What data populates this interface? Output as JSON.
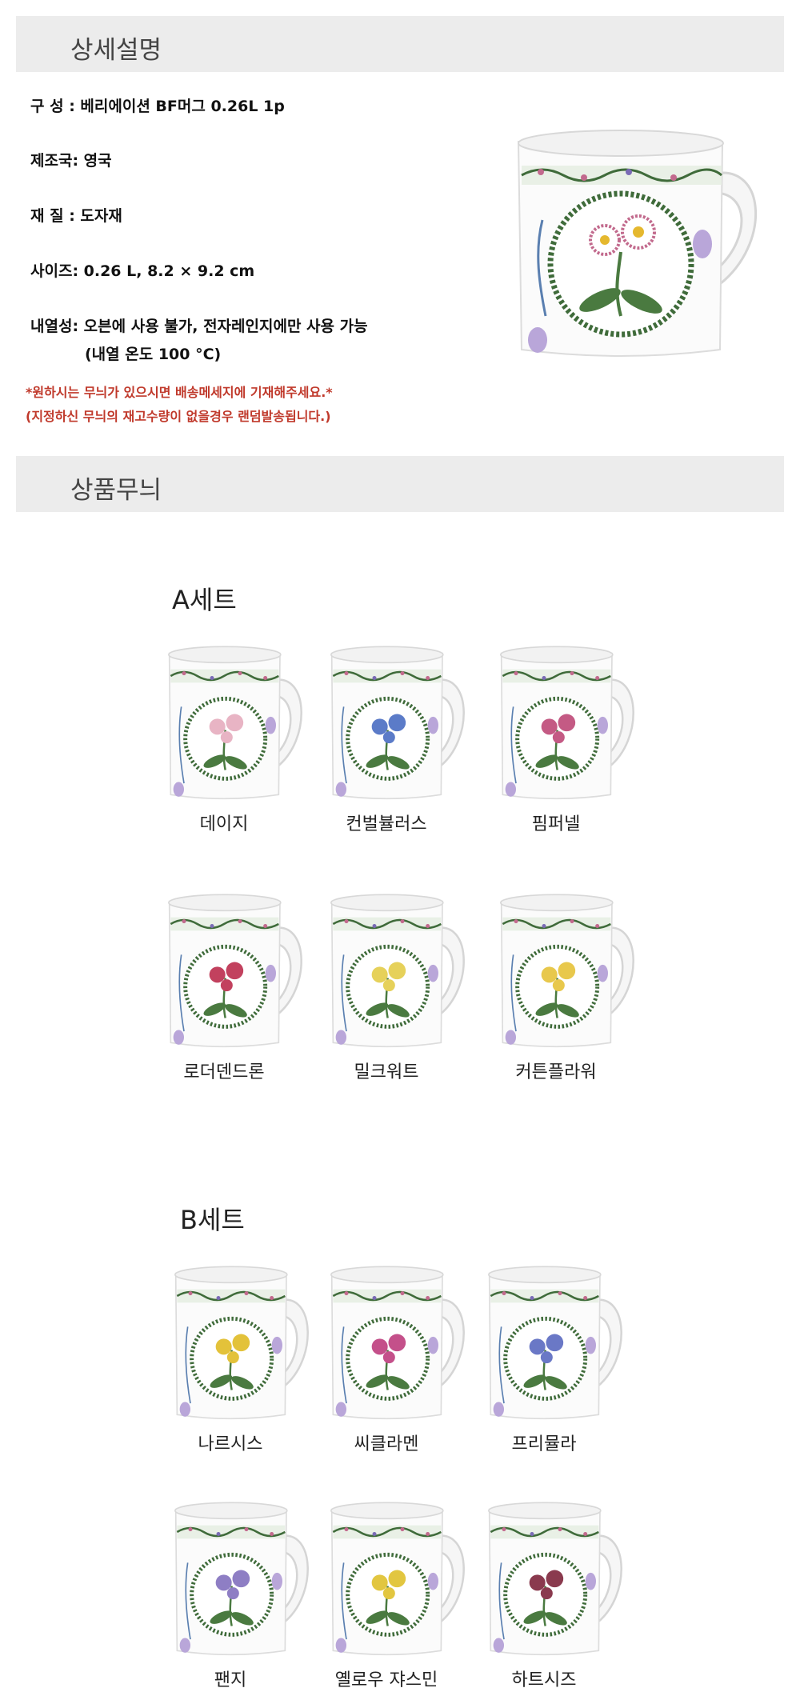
{
  "detail": {
    "title": "상세설명",
    "specs": [
      "구 성 : 베리에이션 BF머그 0.26L  1p",
      "제조국: 영국",
      "재 질 : 도자재",
      "사이즈: 0.26 L, 8.2 × 9.2 cm",
      "내열성: 오븐에 사용 불가, 전자레인지에만 사용 가능",
      "(내열 온도 100 °C)"
    ],
    "notes": [
      "*원하시는 무늬가 있으시면 배송메세지에 기재해주세요.*",
      "(지정하신 무늬의 재고수량이 없을경우 랜덤발송됩니다.)"
    ]
  },
  "patterns": {
    "title": "상품무늬",
    "set_a": {
      "title": "A세트",
      "items": [
        "데이지",
        "컨벌뷸러스",
        "핌퍼넬",
        "로더덴드론",
        "밀크워트",
        "커튼플라워"
      ]
    },
    "set_b": {
      "title": "B세트",
      "items": [
        "나르시스",
        "씨클라멘",
        "프리뮬라",
        "팬지",
        "옐로우 쟈스민",
        "하트시즈"
      ]
    }
  },
  "colors": {
    "section_bar": "#ececec",
    "note_red": "#c0392b",
    "leaf_green": "#3f6b3a"
  }
}
